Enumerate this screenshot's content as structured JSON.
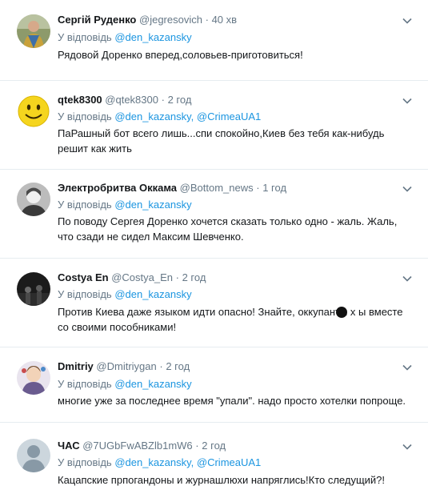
{
  "reply_prefix": "У відповідь",
  "tweets": [
    {
      "name": "Сергій Руденко",
      "handle": "@jegresovich",
      "time": "40 хв",
      "mentions": [
        "@den_kazansky"
      ],
      "text": "Рядовой Доренко вперед,соловьев-приготовиться!",
      "avatar": "person-photo-avatar"
    },
    {
      "name": "qtek8300",
      "handle": "@qtek8300",
      "time": "2 год",
      "mentions": [
        "@den_kazansky",
        "@CrimeaUA1"
      ],
      "text": "ПаРашный бот всего лишь...спи спокойно,Киев без тебя как-нибудь решит как жить",
      "avatar": "smiley-avatar"
    },
    {
      "name": "Электробритва Оккама",
      "handle": "@Bottom_news",
      "time": "1 год",
      "mentions": [
        "@den_kazansky"
      ],
      "text": "По поводу Сергея Доренко хочется сказать только одно - жаль. Жаль, что сзади не сидел Максим Шевченко.",
      "avatar": "bw-portrait-avatar"
    },
    {
      "name": "Costya En",
      "handle": "@Costya_En",
      "time": "2 год",
      "mentions": [
        "@den_kazansky"
      ],
      "text": "Против Киева даже языком идти опасно! Знайте, оккупанты х   ы вместе со своими пособниками!",
      "avatar": "dark-photo-avatar"
    },
    {
      "name": "Dmitriy",
      "handle": "@Dmitriygan",
      "time": "2 год",
      "mentions": [
        "@den_kazansky"
      ],
      "text": "многие уже за последнее время \"упали\". надо просто хотелки попроще.",
      "avatar": "cartoon-avatar"
    },
    {
      "name": "ЧАС",
      "handle": "@7UGbFwABZlb1mW6",
      "time": "2 год",
      "mentions": [
        "@den_kazansky",
        "@CrimeaUA1"
      ],
      "text": "Кацапские прпогандоны и журнашлюхи напряглись!Кто следущий?!",
      "avatar": "default-avatar"
    }
  ]
}
